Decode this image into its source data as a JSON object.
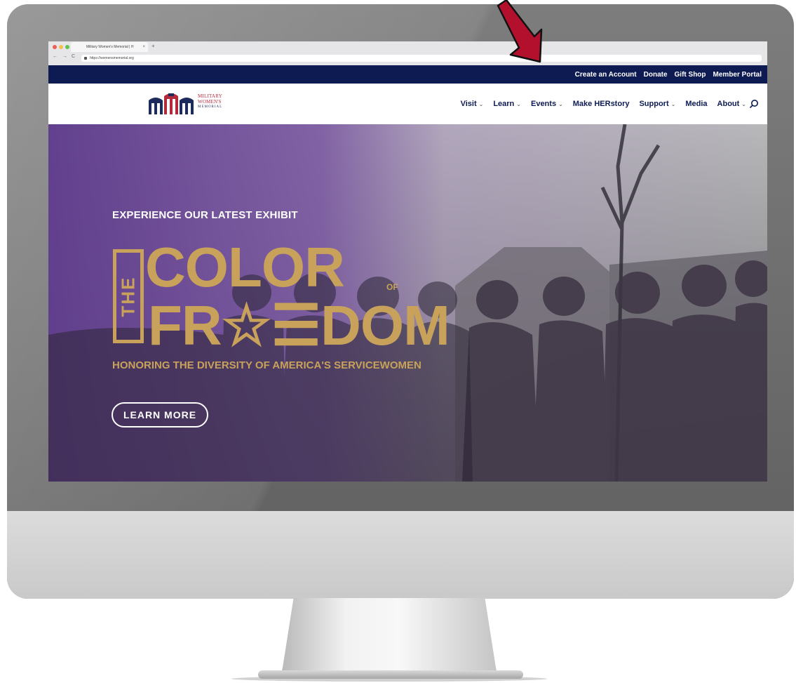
{
  "browser": {
    "tab_title": "Military Women's Memorial | H",
    "tab_close": "×",
    "new_tab": "+",
    "url": "https://womensmemorial.org",
    "back": "←",
    "forward": "→",
    "reload": "C"
  },
  "utility_nav": {
    "items": [
      "Create an Account",
      "Donate",
      "Gift Shop",
      "Member Portal"
    ]
  },
  "logo": {
    "line1": "MILITARY",
    "line2": "WOMEN'S",
    "line3": "MEMORIAL"
  },
  "main_nav": {
    "items": [
      {
        "label": "Visit",
        "has_dropdown": true
      },
      {
        "label": "Learn",
        "has_dropdown": true
      },
      {
        "label": "Events",
        "has_dropdown": true
      },
      {
        "label": "Make HERstory",
        "has_dropdown": false
      },
      {
        "label": "Support",
        "has_dropdown": true
      },
      {
        "label": "Media",
        "has_dropdown": false
      },
      {
        "label": "About",
        "has_dropdown": true
      }
    ],
    "caret": "⌄",
    "search_icon": "search-icon"
  },
  "hero": {
    "eyebrow": "EXPERIENCE OUR LATEST EXHIBIT",
    "the": "THE",
    "word1": "COLOR",
    "of": "OF",
    "word2": "FR☆☰DOM",
    "tagline": "HONORING THE DIVERSITY OF AMERICA'S SERVICEWOMEN",
    "cta": "LEARN MORE"
  },
  "colors": {
    "utility_bar": "#0d1b52",
    "gold": "#c8a25a",
    "purple": "#5f3c8c",
    "arrow": "#b3102e"
  }
}
